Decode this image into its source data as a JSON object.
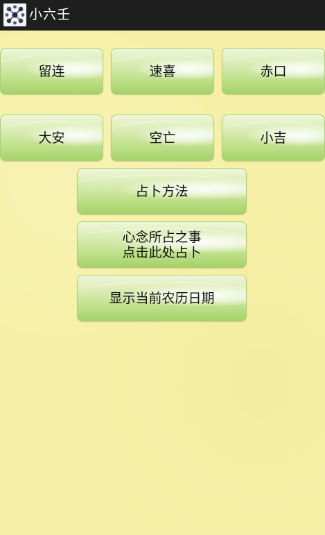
{
  "app": {
    "title": "小六壬",
    "icon": "app-logo-icon"
  },
  "grid_buttons": [
    {
      "label": "留连"
    },
    {
      "label": "速喜"
    },
    {
      "label": "赤口"
    },
    {
      "label": "大安"
    },
    {
      "label": "空亡"
    },
    {
      "label": "小吉"
    }
  ],
  "actions": {
    "method_label": "占卜方法",
    "divine_label_line1": "心念所占之事",
    "divine_label_line2": "点击此处占卜",
    "lunar_label": "显示当前农历日期"
  },
  "colors": {
    "titlebar": "#1e1e1e",
    "background": "#f6f0a6",
    "button_green": "#bfe08a"
  }
}
